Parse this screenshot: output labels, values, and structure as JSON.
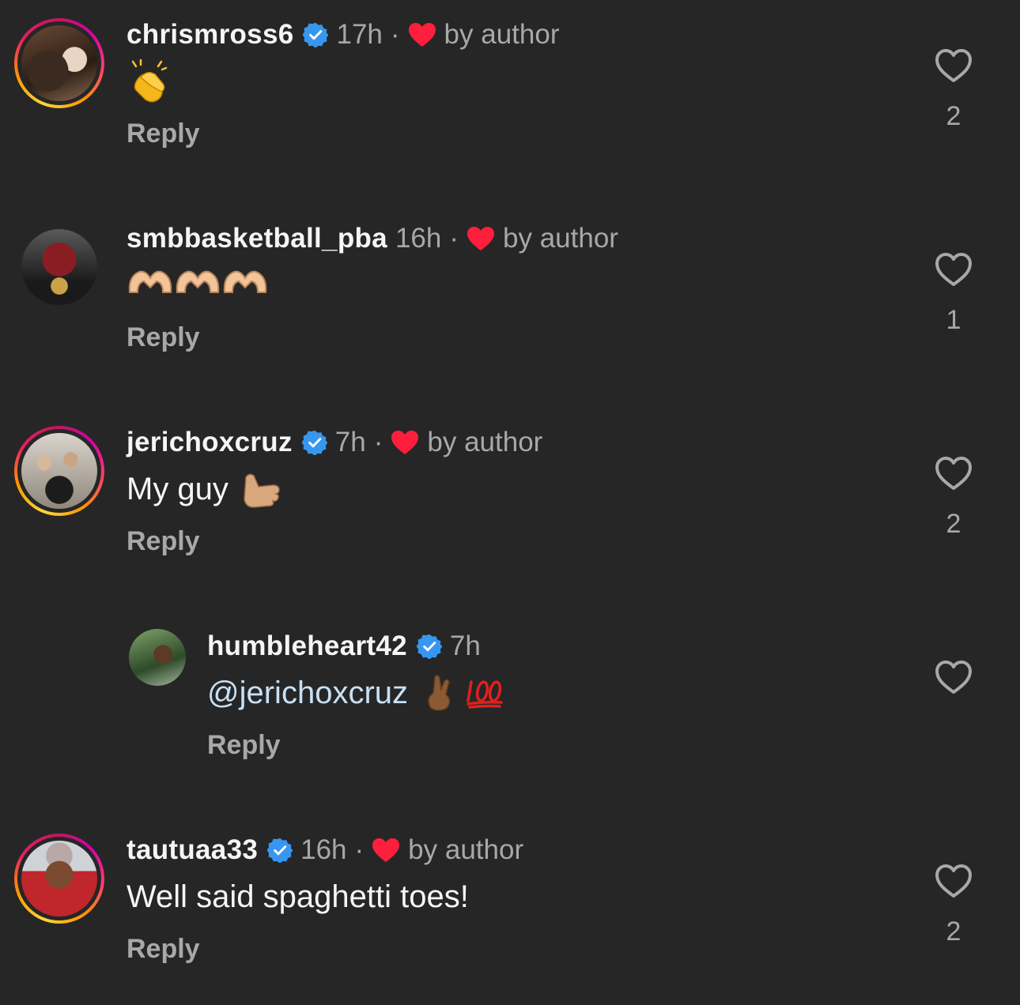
{
  "comments": [
    {
      "username": "chrismross6",
      "verified": true,
      "time": "17h",
      "separator": "·",
      "liked_by_author": "by author",
      "text": "",
      "emoji": "clapping-hands",
      "reply_label": "Reply",
      "like_count": "2"
    },
    {
      "username": "smbbasketball_pba",
      "verified": false,
      "time": "16h",
      "separator": "·",
      "liked_by_author": "by author",
      "text": "",
      "emoji": "heart-hands x3",
      "reply_label": "Reply",
      "like_count": "1"
    },
    {
      "username": "jerichoxcruz",
      "verified": true,
      "time": "7h",
      "separator": "·",
      "liked_by_author": "by author",
      "text": "My guy",
      "emoji": "call-me-hand",
      "reply_label": "Reply",
      "like_count": "2"
    },
    {
      "username": "humbleheart42",
      "verified": true,
      "time": "7h",
      "mention": "@jerichoxcruz",
      "emoji": "crossed-fingers hundred-points",
      "reply_label": "Reply",
      "like_count": ""
    },
    {
      "username": "tautuaa33",
      "verified": true,
      "time": "16h",
      "separator": "·",
      "liked_by_author": "by author",
      "text": "Well said spaghetti toes!",
      "reply_label": "Reply",
      "like_count": "2"
    }
  ],
  "colors": {
    "background": "#262626",
    "verified_badge": "#3797f0",
    "author_heart": "#ff1f3d",
    "muted_text": "#a8a8a8"
  }
}
